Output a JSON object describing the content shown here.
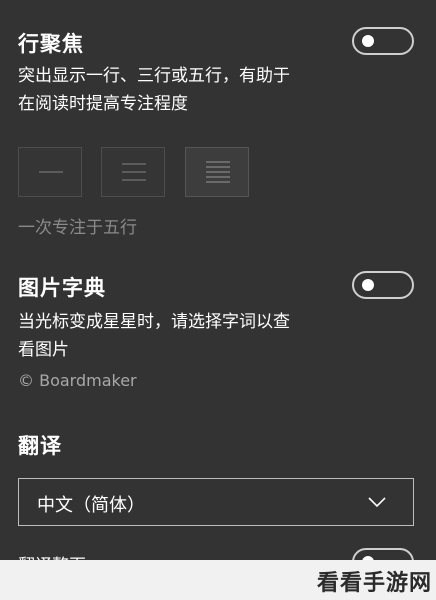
{
  "line_focus": {
    "title": "行聚焦",
    "description_line1": "突出显示一行、三行或五行，有助于",
    "description_line2": "在阅读时提高专注程度",
    "status": "一次专注于五行",
    "options": [
      "一行",
      "三行",
      "五行"
    ],
    "selected_option": "五行",
    "enabled": false
  },
  "picture_dictionary": {
    "title": "图片字典",
    "description_line1": "当光标变成星星时，请选择字词以查",
    "description_line2": "看图片",
    "credit": "© Boardmaker",
    "enabled": false
  },
  "translate": {
    "title": "翻译",
    "language_value": "中文（简体）",
    "translate_page_label": "翻译整页"
  },
  "watermark": {
    "text": "看看手游网"
  },
  "colors": {
    "panel_background": "#333333",
    "text": "#ffffff",
    "muted_text": "#8a8a8a"
  }
}
